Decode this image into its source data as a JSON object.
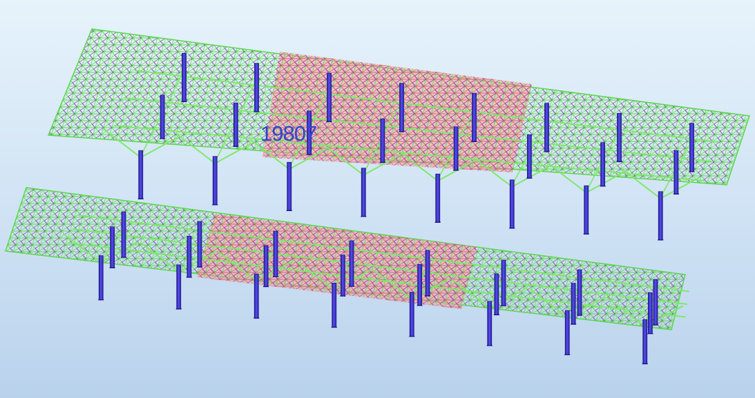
{
  "viewport": {
    "background_top": "#e6f3fb",
    "background_bottom": "#b9d2ec"
  },
  "model": {
    "structures": [
      "upper-canopy",
      "lower-canopy"
    ],
    "colors": {
      "mesh_green": "#5ad84a",
      "mesh_light_green": "#9ef08c",
      "mesh_magenta": "#9c2cc8",
      "mesh_dark_green": "#2f8a3a",
      "stress_zone": "#f07a6c",
      "stress_zone_hot": "#e8567a",
      "column_blue": "#4b3ee0",
      "column_dark": "#1f1a8c",
      "truss_green": "#7ee86a"
    }
  },
  "label": {
    "text": "19807",
    "color": "#2f47c8"
  }
}
